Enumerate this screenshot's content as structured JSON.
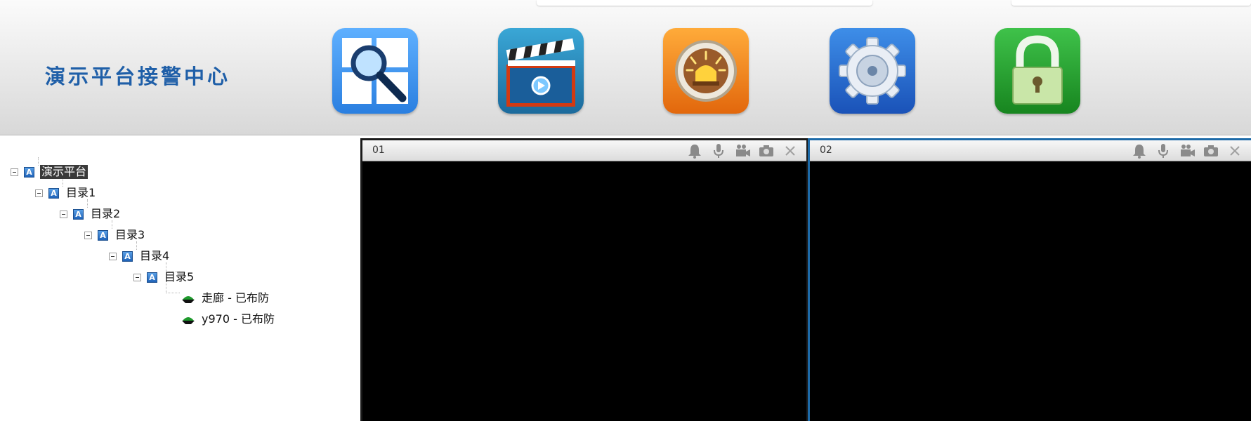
{
  "header": {
    "title": "演示平台接警中心",
    "toolbar": [
      {
        "icon": "search-layout-icon"
      },
      {
        "icon": "video-clapper-icon"
      },
      {
        "icon": "alarm-light-icon"
      },
      {
        "icon": "settings-gear-icon"
      },
      {
        "icon": "lock-icon"
      }
    ]
  },
  "tree": {
    "nodes": [
      {
        "label": "演示平台",
        "level": 0,
        "selected": true
      },
      {
        "label": "目录1",
        "level": 1
      },
      {
        "label": "目录2",
        "level": 2
      },
      {
        "label": "目录3",
        "level": 3
      },
      {
        "label": "目录4",
        "level": 4
      },
      {
        "label": "目录5",
        "level": 5
      }
    ],
    "devices": [
      {
        "label": "走廊 - 已布防",
        "status": "已布防"
      },
      {
        "label": "y970 - 已布防",
        "status": "已布防"
      }
    ]
  },
  "panes": [
    {
      "number": "01",
      "icons": [
        "bell-icon",
        "microphone-icon",
        "video-camera-icon",
        "snapshot-camera-icon",
        "close-icon"
      ]
    },
    {
      "number": "02",
      "icons": [
        "bell-icon",
        "microphone-icon",
        "video-camera-icon",
        "snapshot-camera-icon",
        "close-icon"
      ]
    }
  ],
  "colors": {
    "title": "#1f5fa8",
    "active_pane_border": "#1d6aa8",
    "pane_background": "#000000"
  }
}
